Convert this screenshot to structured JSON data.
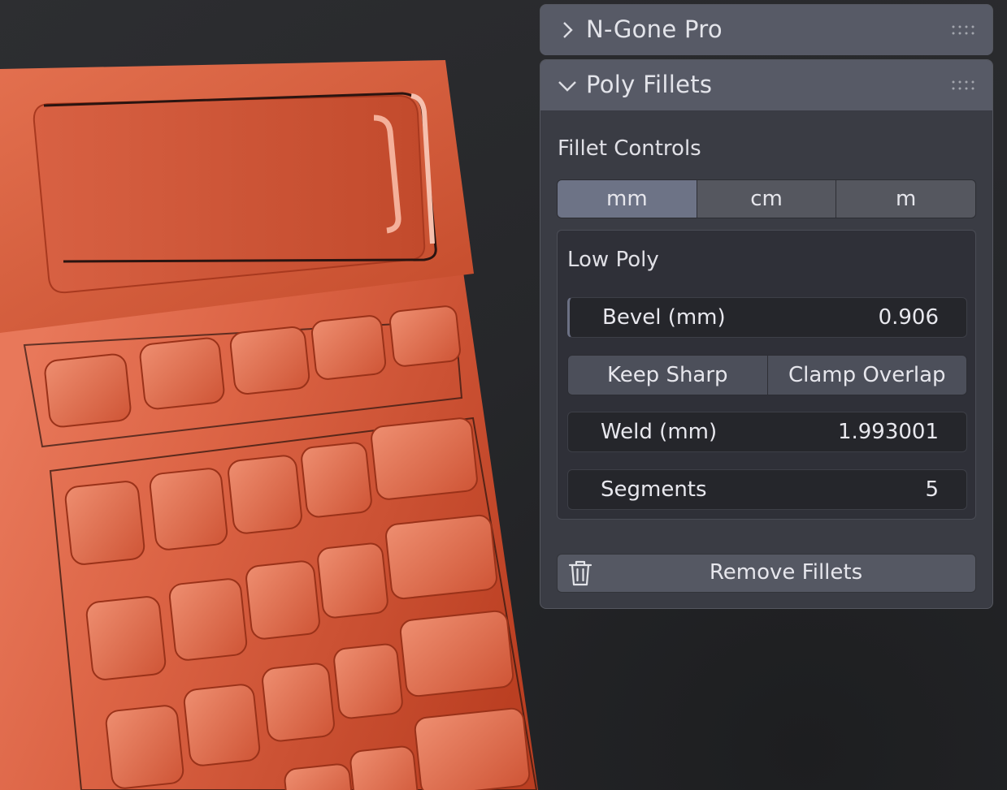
{
  "panels": {
    "ngone": {
      "title": "N-Gone Pro",
      "expanded": false
    },
    "poly": {
      "title": "Poly Fillets",
      "expanded": true,
      "section_label": "Fillet Controls",
      "units": [
        {
          "label": "mm",
          "active": true
        },
        {
          "label": "cm",
          "active": false
        },
        {
          "label": "m",
          "active": false
        }
      ],
      "low_poly": {
        "label": "Low Poly",
        "bevel": {
          "label": "Bevel (mm)",
          "value": "0.906"
        },
        "keep_sharp": "Keep Sharp",
        "clamp_overlap": "Clamp Overlap",
        "weld": {
          "label": "Weld (mm)",
          "value": "1.993001"
        },
        "segments": {
          "label": "Segments",
          "value": "5"
        }
      },
      "remove_label": "Remove Fillets"
    }
  },
  "icons": {
    "collapsed": "chevron-right-icon",
    "expanded": "chevron-down-icon",
    "drag": "grip-dots-icon",
    "remove": "trash-icon"
  },
  "colors": {
    "model": "#c94a2c",
    "panel_header": "#575a66",
    "panel_body": "#3a3c44",
    "active_unit": "#6d7386"
  }
}
